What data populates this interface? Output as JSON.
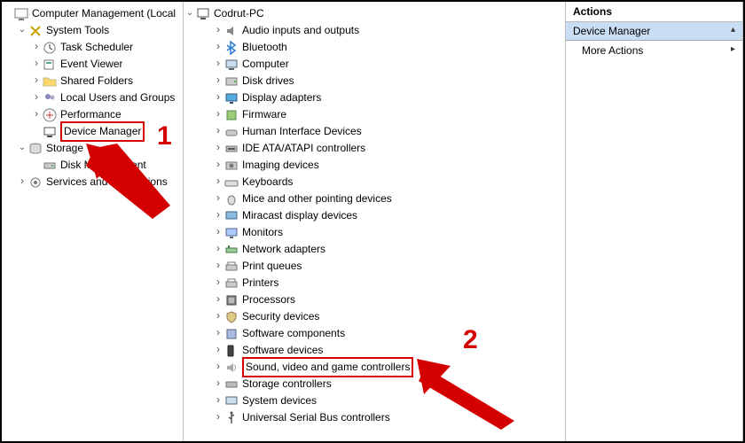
{
  "left_tree": {
    "root": "Computer Management (Local",
    "system_tools": "System Tools",
    "task_scheduler": "Task Scheduler",
    "event_viewer": "Event Viewer",
    "shared_folders": "Shared Folders",
    "local_users": "Local Users and Groups",
    "performance": "Performance",
    "device_manager": "Device Manager",
    "storage": "Storage",
    "disk_management": "Disk Management",
    "services_apps": "Services and Applications"
  },
  "mid_tree": {
    "root": "Codrut-PC",
    "categories": [
      {
        "id": "audio",
        "label": "Audio inputs and outputs"
      },
      {
        "id": "bluetooth",
        "label": "Bluetooth"
      },
      {
        "id": "computer",
        "label": "Computer"
      },
      {
        "id": "disk",
        "label": "Disk drives"
      },
      {
        "id": "display",
        "label": "Display adapters"
      },
      {
        "id": "firmware",
        "label": "Firmware"
      },
      {
        "id": "hid",
        "label": "Human Interface Devices"
      },
      {
        "id": "ide",
        "label": "IDE ATA/ATAPI controllers"
      },
      {
        "id": "imaging",
        "label": "Imaging devices"
      },
      {
        "id": "keyboards",
        "label": "Keyboards"
      },
      {
        "id": "mice",
        "label": "Mice and other pointing devices"
      },
      {
        "id": "miracast",
        "label": "Miracast display devices"
      },
      {
        "id": "monitors",
        "label": "Monitors"
      },
      {
        "id": "network",
        "label": "Network adapters"
      },
      {
        "id": "printqueues",
        "label": "Print queues"
      },
      {
        "id": "printers",
        "label": "Printers"
      },
      {
        "id": "processors",
        "label": "Processors"
      },
      {
        "id": "security",
        "label": "Security devices"
      },
      {
        "id": "swcomp",
        "label": "Software components"
      },
      {
        "id": "swdev",
        "label": "Software devices"
      },
      {
        "id": "sound",
        "label": "Sound, video and game controllers"
      },
      {
        "id": "storage",
        "label": "Storage controllers"
      },
      {
        "id": "system",
        "label": "System devices"
      },
      {
        "id": "usb",
        "label": "Universal Serial Bus controllers"
      }
    ],
    "highlighted_id": "sound"
  },
  "right_pane": {
    "title": "Actions",
    "section": "Device Manager",
    "item": "More Actions"
  },
  "annotations": {
    "marker1": "1",
    "marker2": "2"
  }
}
